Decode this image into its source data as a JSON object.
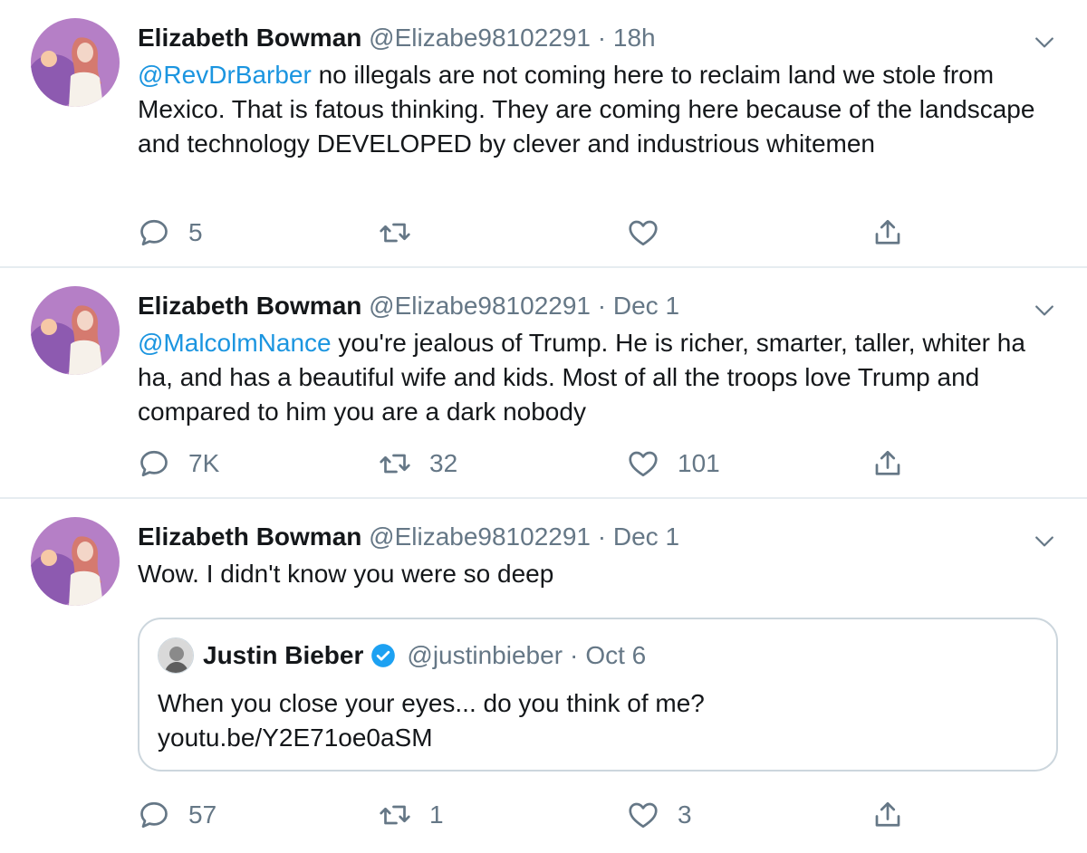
{
  "tweets": [
    {
      "author_name": "Elizabeth Bowman",
      "handle": "@Elizabe98102291",
      "separator": "·",
      "time": "18h",
      "mention": "@RevDrBarber",
      "text": " no illegals are not coming here to reclaim land we stole from Mexico. That is fatous thinking. They are coming here because of the landscape and technology DEVELOPED by clever and industrious whitemen",
      "replies": "5",
      "retweets": "",
      "likes": ""
    },
    {
      "author_name": "Elizabeth Bowman",
      "handle": "@Elizabe98102291",
      "separator": "·",
      "time": "Dec 1",
      "mention": "@MalcolmNance",
      "text": " you're jealous of Trump. He is richer, smarter, taller, whiter ha ha, and has a beautiful wife and kids. Most of all the troops love Trump and compared to him you are a dark nobody",
      "replies": "7K",
      "retweets": "32",
      "likes": "101"
    },
    {
      "author_name": "Elizabeth Bowman",
      "handle": "@Elizabe98102291",
      "separator": "·",
      "time": "Dec 1",
      "text": "Wow. I didn't know you were so deep",
      "replies": "57",
      "retweets": "1",
      "likes": "3",
      "quote": {
        "author_name": "Justin Bieber",
        "handle": "@justinbieber",
        "separator": "·",
        "time": "Oct 6",
        "line1": "When you close your eyes... do you think of me?",
        "line2": "youtu.be/Y2E71oe0aSM"
      }
    }
  ],
  "icons": {
    "reply": "reply-icon",
    "retweet": "retweet-icon",
    "like": "heart-icon",
    "share": "share-icon",
    "menu": "chevron-down-icon",
    "verified": "verified-badge-icon"
  },
  "colors": {
    "link": "#1b95e0",
    "muted": "#657786",
    "border": "#e6ecf0",
    "verified": "#1da1f2"
  }
}
